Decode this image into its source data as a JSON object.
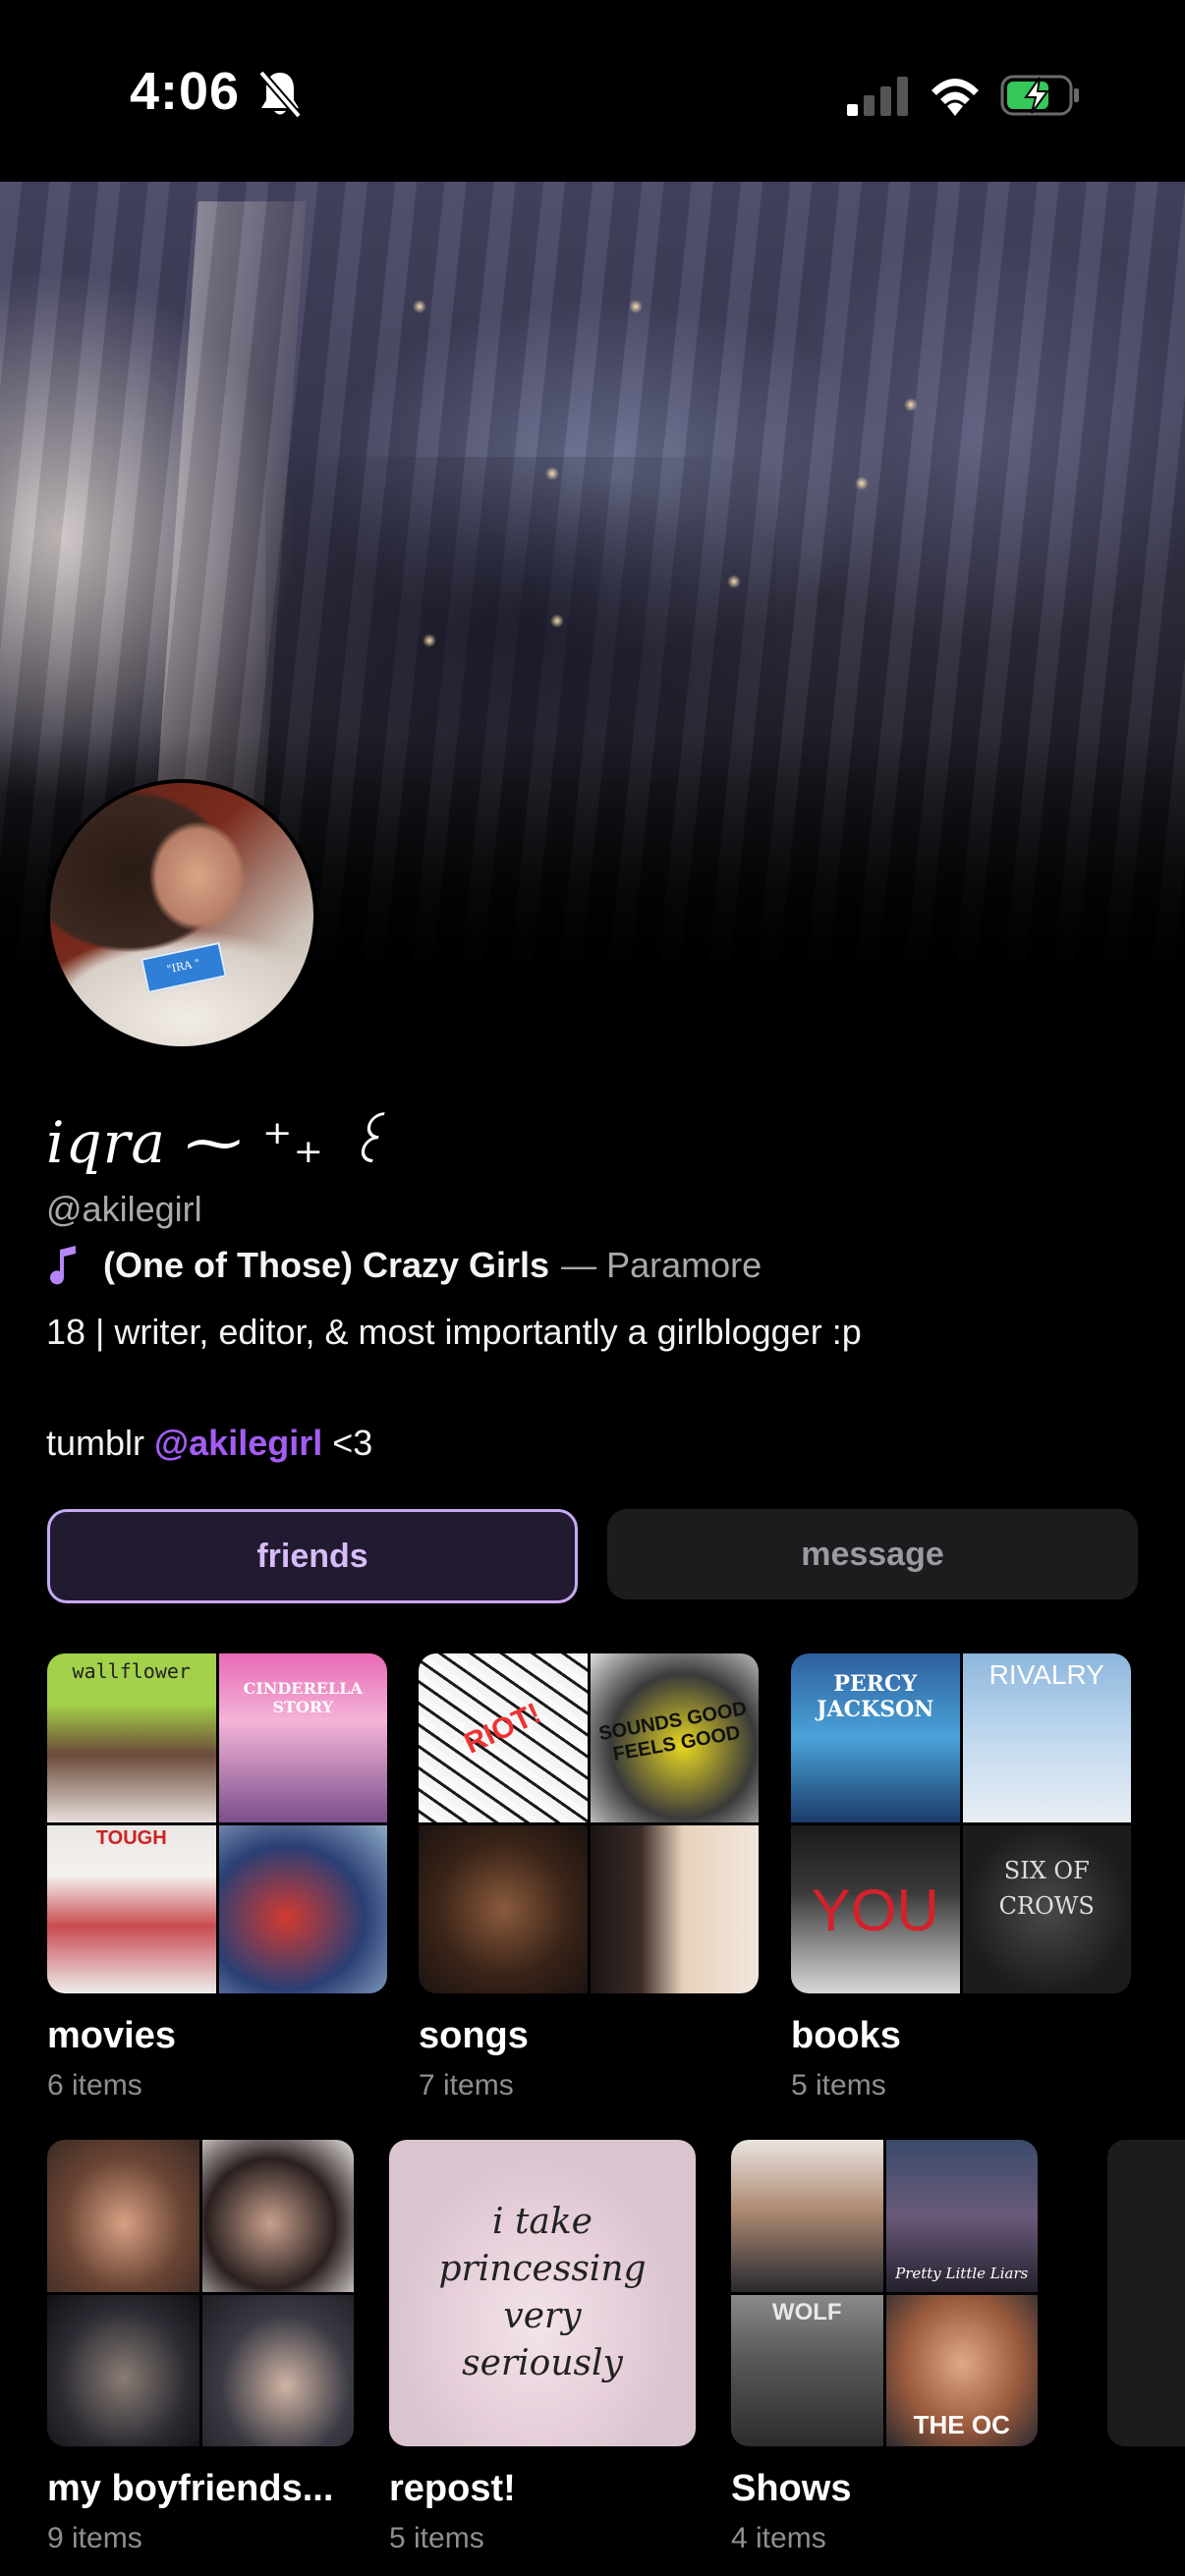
{
  "status_bar": {
    "time": "4:06",
    "icons": [
      "bell-slash-icon",
      "cellular-signal-icon",
      "wifi-icon",
      "battery-charging-icon"
    ]
  },
  "profile": {
    "display_name": "iqra ⁓ ⁺₊ ꒰",
    "username": "@akilegirl",
    "now_playing": {
      "icon": "music-note-icon",
      "title": "(One of Those) Crazy Girls",
      "separator": "—",
      "artist": "Paramore"
    },
    "bio": "18 | writer, editor, & most importantly a girlblogger :p",
    "tumblr": {
      "prefix": "tumblr",
      "handle": "@akilegirl",
      "suffix": "<3"
    },
    "avatar_card_text": "\"IRA \""
  },
  "actions": {
    "friends_label": "friends",
    "message_label": "message"
  },
  "colors": {
    "accent": "#a45cf4",
    "friends_border": "#c8a9f3",
    "muted": "#8e8e93"
  },
  "collections": [
    {
      "title": "movies",
      "count": "6 items",
      "covers": [
        "wallflower",
        "CINDERELLA STORY",
        "TOUGH",
        ""
      ]
    },
    {
      "title": "songs",
      "count": "7 items",
      "covers": [
        "RIOT!",
        "SOUNDS GOOD FEELS GOOD",
        "",
        ""
      ]
    },
    {
      "title": "books",
      "count": "5 items",
      "covers": [
        "PERCY JACKSON",
        "RIVALRY",
        "YOU",
        "SIX OF CROWS"
      ]
    },
    {
      "title": "my boyfriends...",
      "count": "9 items"
    },
    {
      "title": "repost!",
      "count": "5 items",
      "quote": [
        "i take",
        "princessing",
        "very",
        "seriously"
      ]
    },
    {
      "title": "Shows",
      "count": "4 items",
      "covers": [
        "",
        "Pretty Little Liars",
        "WOLF",
        "THE OC"
      ]
    }
  ]
}
